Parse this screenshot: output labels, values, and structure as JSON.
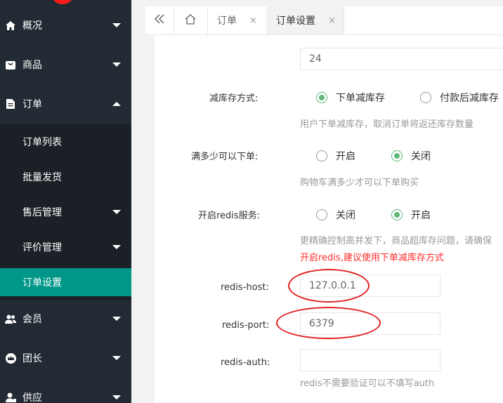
{
  "sidebar": {
    "items": [
      {
        "label": "概况",
        "icon": "home-icon"
      },
      {
        "label": "商品",
        "icon": "bag-icon"
      },
      {
        "label": "订单",
        "icon": "document-icon"
      },
      {
        "label": "会员",
        "icon": "users-icon"
      },
      {
        "label": "团长",
        "icon": "crown-icon"
      },
      {
        "label": "供应",
        "icon": "supplier-icon"
      }
    ],
    "order_submenu": [
      "订单列表",
      "批量发货",
      "售后管理",
      "评价管理",
      "订单设置"
    ],
    "active_sub": "订单设置"
  },
  "tabs": {
    "items": [
      {
        "label": "订单"
      },
      {
        "label": "订单设置"
      }
    ],
    "close_glyph": "×"
  },
  "form": {
    "top_input_value": "24",
    "stock_reduce": {
      "label": "减库存方式:",
      "options": [
        "下单减库存",
        "付款后减库存"
      ],
      "selected": "下单减库存",
      "hint": "用户下单减库存，取消订单将返还库存数量"
    },
    "min_order": {
      "label": "满多少可以下单:",
      "options": [
        "开启",
        "关闭"
      ],
      "selected": "关闭",
      "hint": "购物车满多少才可以下单购买"
    },
    "redis": {
      "label": "开启redis服务:",
      "options": [
        "关闭",
        "开启"
      ],
      "selected": "开启",
      "hint": "更精确控制高并发下，商品超库存问题，请确保",
      "warning": "开启redis,建议使用下单减库存方式"
    },
    "redis_host": {
      "label": "redis-host:",
      "value": "127.0.0.1"
    },
    "redis_port": {
      "label": "redis-port:",
      "value": "6379"
    },
    "redis_auth": {
      "label": "redis-auth:",
      "value": "",
      "hint": "redis不需要验证可以不填写auth"
    }
  },
  "colors": {
    "accent": "#009688",
    "radio_checked": "#5fb878",
    "warning": "#ff2a2a",
    "annotation": "#e02020"
  }
}
